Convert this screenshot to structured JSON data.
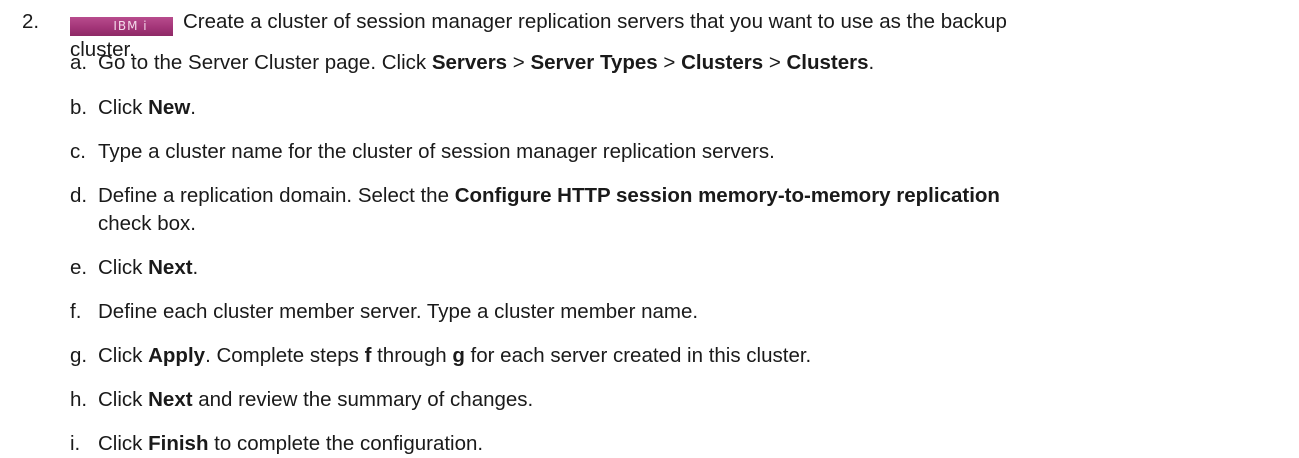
{
  "step": {
    "number": "2.",
    "badge": "IBM i",
    "line1": "Create a cluster of session manager replication servers that you want to use as the backup",
    "line2": "cluster."
  },
  "substeps": [
    {
      "letter": "a.",
      "parts": [
        {
          "t": "Go to the Server Cluster page. Click ",
          "b": false
        },
        {
          "t": "Servers",
          "b": true
        },
        {
          "t": " > ",
          "b": false
        },
        {
          "t": "Server Types",
          "b": true
        },
        {
          "t": " > ",
          "b": false
        },
        {
          "t": "Clusters",
          "b": true
        },
        {
          "t": " > ",
          "b": false
        },
        {
          "t": "Clusters",
          "b": true
        },
        {
          "t": ".",
          "b": false
        }
      ]
    },
    {
      "letter": "b.",
      "parts": [
        {
          "t": "Click ",
          "b": false
        },
        {
          "t": "New",
          "b": true
        },
        {
          "t": ".",
          "b": false
        }
      ]
    },
    {
      "letter": "c.",
      "parts": [
        {
          "t": "Type a cluster name for the cluster of session manager replication servers.",
          "b": false
        }
      ]
    },
    {
      "letter": "d.",
      "parts": [
        {
          "t": "Define a replication domain. Select the ",
          "b": false
        },
        {
          "t": "Configure HTTP session memory-to-memory replication",
          "b": true
        }
      ],
      "continuation": "check box."
    },
    {
      "letter": "e.",
      "parts": [
        {
          "t": "Click ",
          "b": false
        },
        {
          "t": "Next",
          "b": true
        },
        {
          "t": ".",
          "b": false
        }
      ]
    },
    {
      "letter": "f.",
      "parts": [
        {
          "t": "Define each cluster member server. Type a cluster member name.",
          "b": false
        }
      ]
    },
    {
      "letter": "g.",
      "parts": [
        {
          "t": "Click ",
          "b": false
        },
        {
          "t": "Apply",
          "b": true
        },
        {
          "t": ". Complete steps ",
          "b": false
        },
        {
          "t": "f",
          "b": true
        },
        {
          "t": " through ",
          "b": false
        },
        {
          "t": "g",
          "b": true
        },
        {
          "t": " for each server created in this cluster.",
          "b": false
        }
      ]
    },
    {
      "letter": "h.",
      "parts": [
        {
          "t": "Click ",
          "b": false
        },
        {
          "t": "Next",
          "b": true
        },
        {
          "t": " and review the summary of changes.",
          "b": false
        }
      ]
    },
    {
      "letter": "i.",
      "parts": [
        {
          "t": "Click ",
          "b": false
        },
        {
          "t": "Finish",
          "b": true
        },
        {
          "t": " to complete the configuration.",
          "b": false
        }
      ]
    }
  ]
}
